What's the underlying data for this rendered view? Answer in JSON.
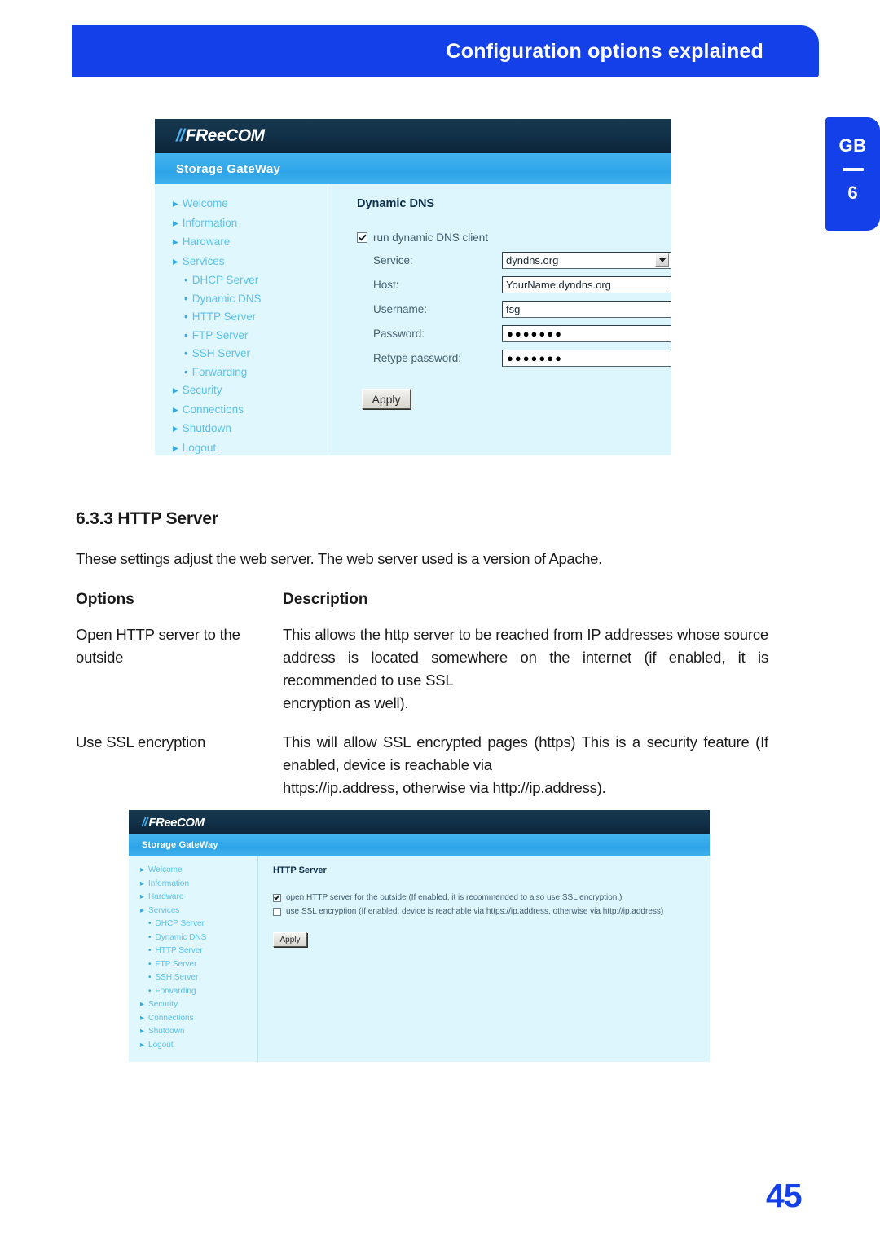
{
  "header": {
    "title": "Configuration options explained"
  },
  "chapter_tab": {
    "language": "GB",
    "chapter": "6"
  },
  "page_number": "45",
  "colors": {
    "accent_blue": "#1340e8",
    "panel_header_dark": "#12324a",
    "panel_product_bar": "#2ea4e8",
    "panel_background": "#ddf5fd",
    "nav_link": "#5bc2ea"
  },
  "screenshot_dyndns": {
    "brand": {
      "bars": "//",
      "word": "FReeCOM"
    },
    "product": "Storage GateWay",
    "nav": [
      {
        "label": "Welcome",
        "level": "top"
      },
      {
        "label": "Information",
        "level": "top"
      },
      {
        "label": "Hardware",
        "level": "top"
      },
      {
        "label": "Services",
        "level": "top"
      },
      {
        "label": "DHCP Server",
        "level": "sub"
      },
      {
        "label": "Dynamic DNS",
        "level": "sub"
      },
      {
        "label": "HTTP Server",
        "level": "sub"
      },
      {
        "label": "FTP Server",
        "level": "sub"
      },
      {
        "label": "SSH Server",
        "level": "sub"
      },
      {
        "label": "Forwarding",
        "level": "sub"
      },
      {
        "label": "Security",
        "level": "top"
      },
      {
        "label": "Connections",
        "level": "top"
      },
      {
        "label": "Shutdown",
        "level": "top"
      },
      {
        "label": "Logout",
        "level": "top"
      }
    ],
    "panel_title": "Dynamic DNS",
    "enable_checkbox": {
      "label": "run dynamic DNS client",
      "checked": true
    },
    "fields": [
      {
        "label": "Service:",
        "value": "dyndns.org",
        "type": "select"
      },
      {
        "label": "Host:",
        "value": "YourName.dyndns.org",
        "type": "text"
      },
      {
        "label": "Username:",
        "value": "fsg",
        "type": "text"
      },
      {
        "label": "Password:",
        "value": "●●●●●●●",
        "type": "password"
      },
      {
        "label": "Retype password:",
        "value": "●●●●●●●",
        "type": "password"
      }
    ],
    "apply_button": "Apply"
  },
  "section": {
    "heading": "6.3.3 HTTP Server",
    "intro": "These settings adjust the web server. The web server used is a version of Apache.",
    "table": {
      "headers": {
        "options": "Options",
        "description": "Description"
      },
      "rows": [
        {
          "option": "Open HTTP server to the outside",
          "description": "This allows the http server to be reached from IP addresses whose source address is located somewhere on the internet (if enabled, it is recommended to use SSL",
          "description_last_line": "encryption as well)."
        },
        {
          "option": "Use SSL encryption",
          "description": "This will allow SSL encrypted pages (https) This is a security feature (If enabled, device is reachable via",
          "description_last_line": "https://ip.address, otherwise via http://ip.address)."
        }
      ]
    }
  },
  "screenshot_http": {
    "brand": {
      "bars": "//",
      "word": "FReeCOM"
    },
    "product": "Storage GateWay",
    "nav": [
      {
        "label": "Welcome",
        "level": "top"
      },
      {
        "label": "Information",
        "level": "top"
      },
      {
        "label": "Hardware",
        "level": "top"
      },
      {
        "label": "Services",
        "level": "top"
      },
      {
        "label": "DHCP Server",
        "level": "sub"
      },
      {
        "label": "Dynamic DNS",
        "level": "sub"
      },
      {
        "label": "HTTP Server",
        "level": "sub"
      },
      {
        "label": "FTP Server",
        "level": "sub"
      },
      {
        "label": "SSH Server",
        "level": "sub"
      },
      {
        "label": "Forwarding",
        "level": "sub"
      },
      {
        "label": "Security",
        "level": "top"
      },
      {
        "label": "Connections",
        "level": "top"
      },
      {
        "label": "Shutdown",
        "level": "top"
      },
      {
        "label": "Logout",
        "level": "top"
      }
    ],
    "panel_title": "HTTP Server",
    "checkboxes": [
      {
        "label": "open HTTP server for the outside (If enabled, it is recommended to also use SSL encryption.)",
        "checked": true
      },
      {
        "label": "use SSL encryption (If enabled, device is reachable via https://ip.address, otherwise via http://ip.address)",
        "checked": false
      }
    ],
    "apply_button": "Apply"
  }
}
